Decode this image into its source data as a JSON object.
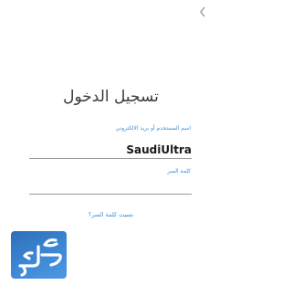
{
  "header": {
    "back_icon": "chevron-left-icon"
  },
  "login": {
    "title": "تسجيل الدخول",
    "username_label": "اسم المستخدم أو بريد الالكتروني",
    "username_value": "SaudiUltra",
    "password_label": "كلمة السر",
    "password_value": "",
    "forgot_link": "نسيت كلمة السر؟"
  },
  "logo": {
    "name": "watermark-logo",
    "text": "المرجع"
  },
  "colors": {
    "accent": "#3b8ed6",
    "title": "#3a3a3a",
    "logo_bg": "#3f8ad8"
  }
}
